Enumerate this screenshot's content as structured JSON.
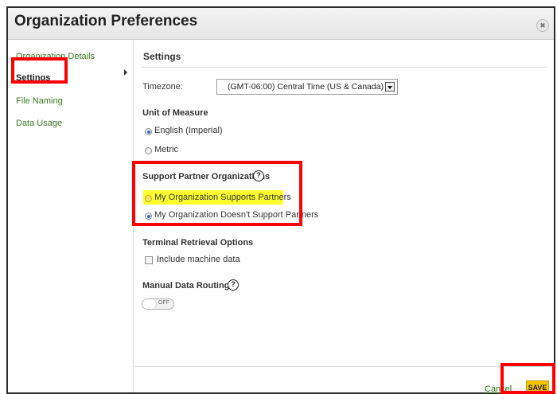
{
  "window": {
    "title": "Organization Preferences",
    "close_symbol": "✖"
  },
  "sidebar": {
    "items": [
      {
        "label": "Organization Details"
      },
      {
        "label": "Settings"
      },
      {
        "label": "File Naming"
      },
      {
        "label": "Data Usage"
      }
    ],
    "active": "Settings"
  },
  "settings": {
    "heading": "Settings",
    "timezone": {
      "label": "Timezone:",
      "value": "(GMT-06:00) Central Time (US & Canada)"
    },
    "unit_of_measure": {
      "heading": "Unit of Measure",
      "options": [
        {
          "label": "English (Imperial)",
          "checked": true
        },
        {
          "label": "Metric",
          "checked": false
        }
      ]
    },
    "support_partner": {
      "heading": "Support Partner Organizations",
      "help_symbol": "?",
      "options": [
        {
          "label": "My Organization Supports Partners",
          "checked": false
        },
        {
          "label": "My Organization Doesn't Support Partners",
          "checked": true
        }
      ]
    },
    "terminal_retrieval": {
      "heading": "Terminal Retrieval Options",
      "checkbox_label": "Include machine data",
      "checked": false
    },
    "manual_routing": {
      "heading": "Manual Data Routing",
      "help_symbol": "?",
      "toggle_label": "OFF"
    }
  },
  "footer": {
    "cancel_label": "Cancel",
    "save_label": "SAVE"
  },
  "colors": {
    "link_green": "#3d7a22",
    "save_yellow": "#f6c400",
    "highlight_yellow": "#ffff2e",
    "annotation_red": "#ff0000"
  }
}
